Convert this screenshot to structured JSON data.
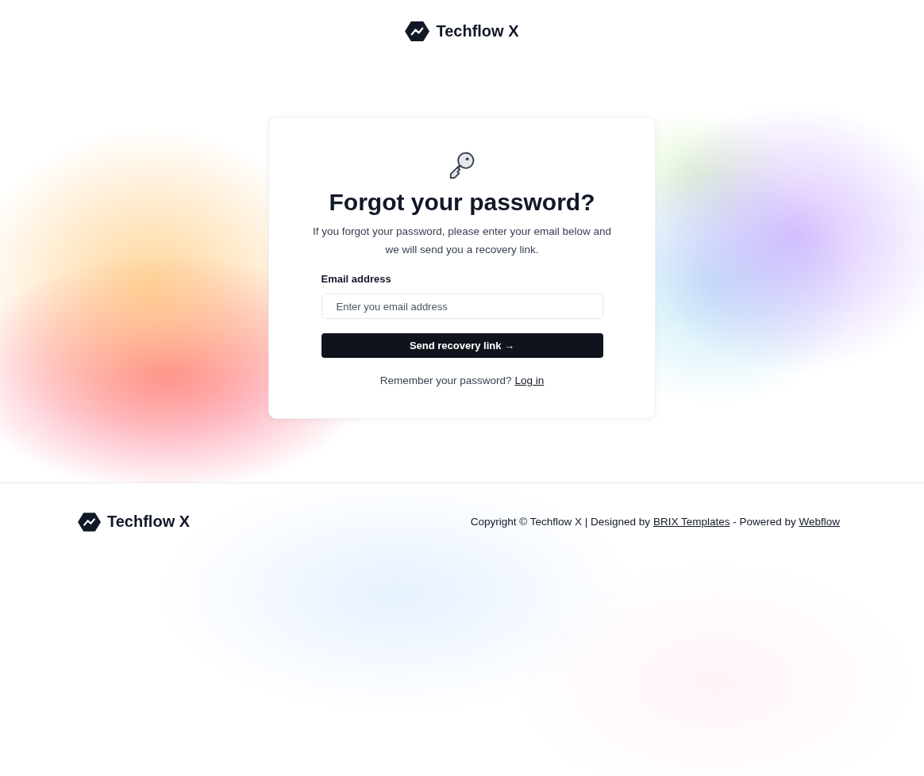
{
  "header": {
    "brand": "Techflow X"
  },
  "card": {
    "title": "Forgot your password?",
    "description": "If you forgot your password, please enter your email below and we will send you a recovery link.",
    "email_label": "Email address",
    "email_placeholder": "Enter you email address",
    "submit_button": "Send recovery link",
    "submit_arrow": "→",
    "login_prompt": "Remember your password?",
    "login_link": "Log in"
  },
  "footer": {
    "brand": "Techflow X",
    "copyright": "Copyright © Techflow X | Designed by ",
    "designer_link": "BRIX Templates",
    "powered_text": " - Powered by ",
    "powered_link": "Webflow"
  }
}
